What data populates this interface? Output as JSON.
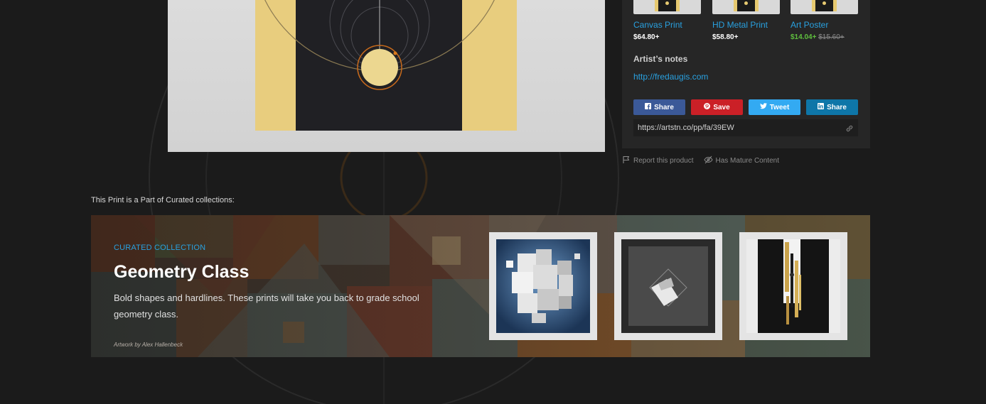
{
  "product_variants": [
    {
      "name": "Canvas Print",
      "price": "$64.80+"
    },
    {
      "name": "HD Metal Print",
      "price": "$58.80+"
    },
    {
      "name": "Art Poster",
      "price": "$14.04+",
      "old_price": "$15.60+"
    }
  ],
  "artist_notes": {
    "heading": "Artist’s notes",
    "link": "http://fredaugis.com"
  },
  "share_buttons": [
    {
      "label": "Share",
      "icon": "facebook-icon",
      "color": "#3b5998"
    },
    {
      "label": "Save",
      "icon": "pinterest-icon",
      "color": "#cb2027"
    },
    {
      "label": "Tweet",
      "icon": "twitter-icon",
      "color": "#33aaf2"
    },
    {
      "label": "Share",
      "icon": "linkedin-icon",
      "color": "#0e76a8"
    }
  ],
  "share_url": "https://artstn.co/pp/fa/39EW",
  "meta_links": {
    "report": "Report this product",
    "mature": "Has Mature Content"
  },
  "collections": {
    "label": "This Print is a Part of Curated collections:",
    "kicker": "CURATED COLLECTION",
    "title": "Geometry Class",
    "description": "Bold shapes and hardlines. These prints will take you back to grade school geometry class.",
    "credit": "Artwork by Alex Hallenbeck"
  },
  "colors": {
    "accent": "#29a1e0",
    "sale_price": "#5fbf3e",
    "gold": "#e6c970"
  }
}
